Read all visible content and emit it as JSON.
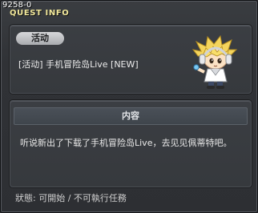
{
  "window": {
    "id_tag": "9258-0",
    "title": "QUEST INFO"
  },
  "quest": {
    "category_label": "活动",
    "name": "[活动] 手机冒险岛Live [NEW]",
    "npc_portrait": "npc-blonde-headphones"
  },
  "details": {
    "section_title": "内容",
    "text": "听说新出了下载了手机冒险岛Live，去见见佩蒂特吧。"
  },
  "footer": {
    "status": "狀態: 可開始 / 不可執行任務"
  },
  "colors": {
    "title": "#f1e79a",
    "panel_bg": "#3b3e43",
    "window_bg": "#303236"
  }
}
